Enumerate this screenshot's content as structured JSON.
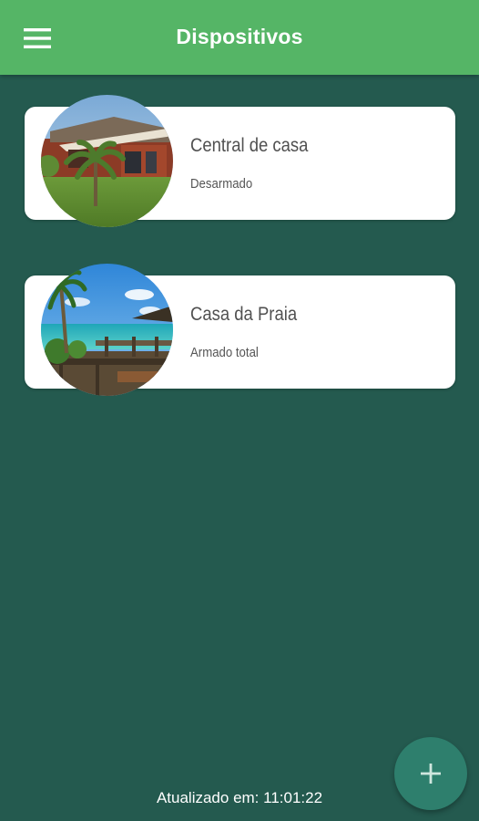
{
  "app_bar": {
    "title": "Dispositivos",
    "menu_icon": "menu-icon"
  },
  "devices": [
    {
      "name": "Central de casa",
      "status": "Desarmado",
      "image": "house-photo"
    },
    {
      "name": "Casa da Praia",
      "status": "Armado total",
      "image": "beach-photo"
    }
  ],
  "footer": {
    "updated_text": "Atualizado em: 11:01:22"
  },
  "fab": {
    "icon": "plus-icon"
  },
  "colors": {
    "app_bar": "#55b566",
    "background": "#245a4f",
    "fab": "#2e7f6d",
    "card": "#ffffff"
  }
}
